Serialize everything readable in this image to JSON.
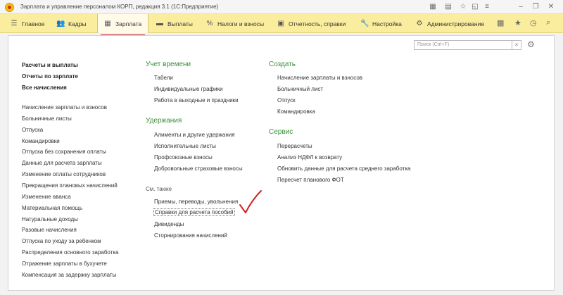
{
  "window": {
    "title": "Зарплата и управление персоналом КОРП, редакция 3.1  (1С:Предприятие)",
    "icons": [
      "grid-icon",
      "calendar-icon",
      "star-icon",
      "window-icon",
      "menu-icon",
      "minimize-icon",
      "restore-icon",
      "close-icon"
    ]
  },
  "menu": {
    "items": [
      {
        "label": "Главное",
        "icon": "list-icon"
      },
      {
        "label": "Кадры",
        "icon": "people-icon"
      },
      {
        "label": "Зарплата",
        "icon": "calculator-icon",
        "active": true
      },
      {
        "label": "Выплаты",
        "icon": "wallet-icon"
      },
      {
        "label": "Налоги и взносы",
        "icon": "percent-icon"
      },
      {
        "label": "Отчетность, справки",
        "icon": "report-icon"
      },
      {
        "label": "Настройка",
        "icon": "wrench-icon"
      },
      {
        "label": "Администрирование",
        "icon": "gear-icon"
      }
    ],
    "accent": "#c9222a",
    "bar_color": "#fbed9e"
  },
  "search": {
    "placeholder": "Поиск (Ctrl+F)",
    "clear": "×"
  },
  "left": {
    "top_links": [
      "Расчеты и выплаты",
      "Отчеты по зарплате",
      "Все начисления"
    ],
    "links": [
      "Начисление зарплаты и взносов",
      "Больничные листы",
      "Отпуска",
      "Командировки",
      "Отпуска без сохранения оплаты",
      "Данные для расчета зарплаты",
      "Изменение оплаты сотрудников",
      "Прекращения плановых начислений",
      "Изменение аванса",
      "Материальная помощь",
      "Натуральные доходы",
      "Разовые начисления",
      "Отпуска по уходу за ребенком",
      "Распределения основного заработка",
      "Отражение зарплаты в бухучете",
      "Компенсация за задержку зарплаты"
    ]
  },
  "middle": {
    "time_title": "Учет времени",
    "time_links": [
      "Табели",
      "Индивидуальные графики",
      "Работа в выходные и праздники"
    ],
    "deduct_title": "Удержания",
    "deduct_links": [
      "Алименты и другие удержания",
      "Исполнительные листы",
      "Профсоюзные взносы",
      "Добровольные страховые взносы"
    ],
    "see_also_title": "См. также",
    "see_also_links": [
      "Приемы, переводы, увольнения",
      "Справки для расчета пособий",
      "Дивиденды",
      "Сторнирования начислений"
    ]
  },
  "right": {
    "create_title": "Создать",
    "create_links": [
      "Начисление зарплаты и взносов",
      "Больничный лист",
      "Отпуск",
      "Командировка"
    ],
    "service_title": "Сервис",
    "service_links": [
      "Перерасчеты",
      "Анализ НДФЛ к возврату",
      "Обновить данные для расчета среднего заработка",
      "Пересчет планового ФОТ"
    ]
  },
  "colors": {
    "section_green": "#3a8f3a",
    "checkmark_red": "#d32020"
  }
}
